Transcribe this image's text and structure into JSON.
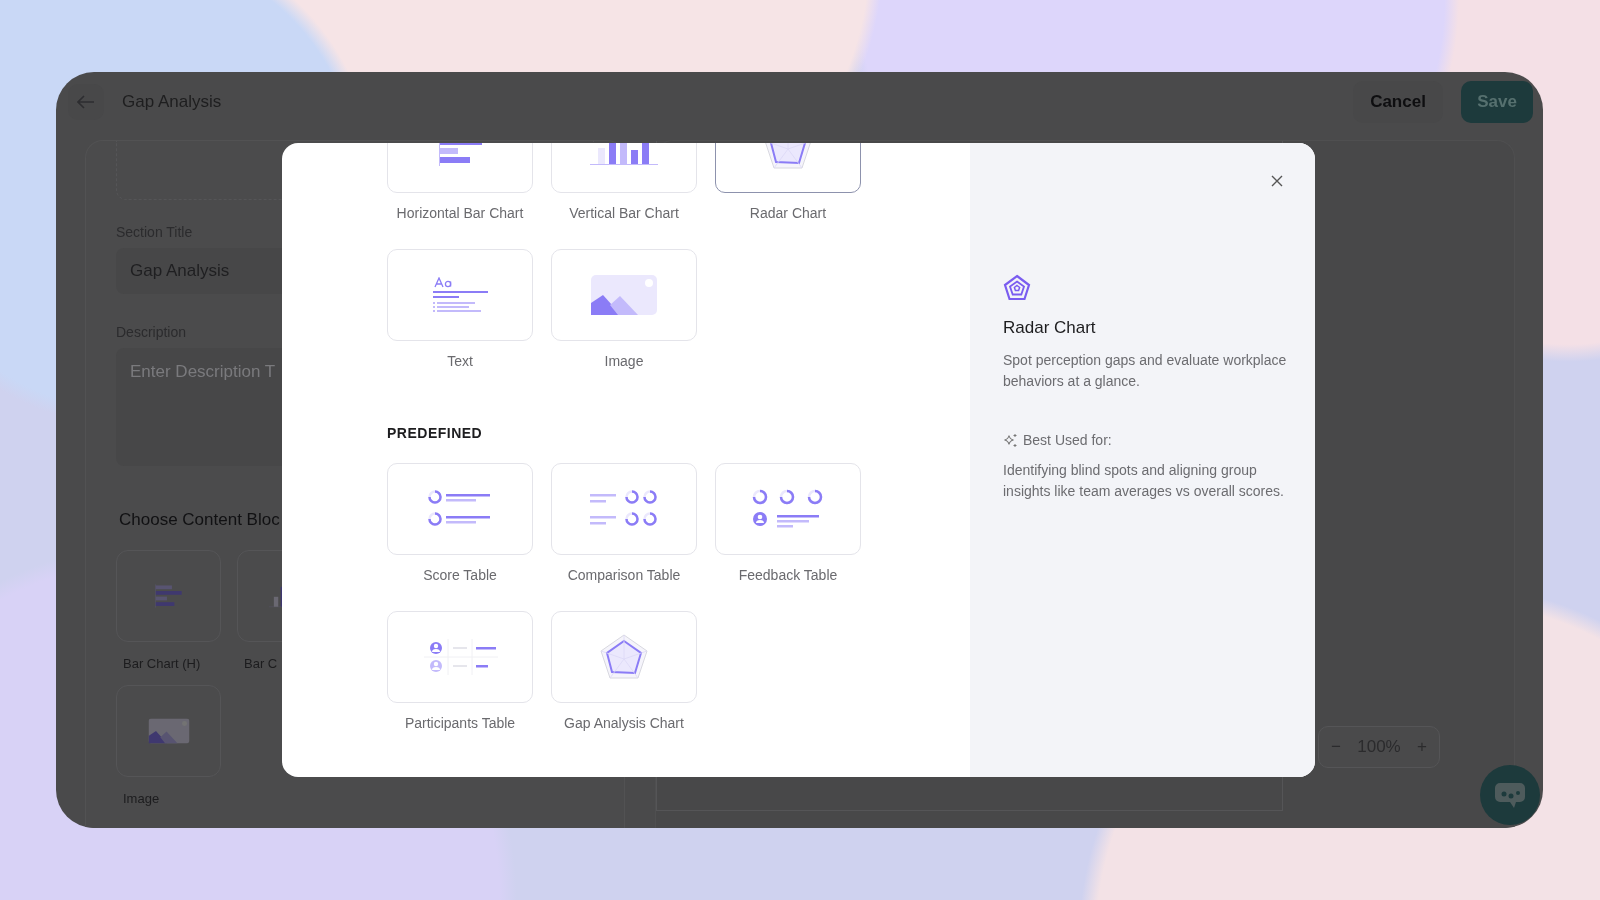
{
  "header": {
    "title": "Gap Analysis",
    "buttons": [
      {
        "label": "Cancel",
        "kind": "secondary"
      },
      {
        "label": "Save",
        "kind": "primary"
      }
    ]
  },
  "editor": {
    "section_title_label": "Section Title",
    "section_title_value": "Gap Analysis",
    "description_label": "Description",
    "description_placeholder": "Enter Description T",
    "blocks_heading": "Choose Content Bloc",
    "blocks": [
      {
        "label": "Bar Chart (H)",
        "kind": "hbar"
      },
      {
        "label": "Bar C",
        "kind": "vbar"
      },
      {
        "label": "Image",
        "kind": "image"
      }
    ]
  },
  "canvas": {
    "zoom": {
      "minus": "−",
      "value": "100%",
      "plus": "+"
    }
  },
  "modal": {
    "groups": [
      {
        "items": [
          {
            "label": "Horizontal Bar Chart",
            "kind": "hbar",
            "selected": false
          },
          {
            "label": "Vertical Bar Chart",
            "kind": "vbar",
            "selected": false
          },
          {
            "label": "Radar Chart",
            "kind": "radar",
            "selected": true
          },
          {
            "label": "Text",
            "kind": "text",
            "selected": false
          },
          {
            "label": "Image",
            "kind": "image",
            "selected": false
          }
        ]
      },
      {
        "heading": "PREDEFINED",
        "items": [
          {
            "label": "Score Table",
            "kind": "score",
            "selected": false
          },
          {
            "label": "Comparison Table",
            "kind": "comparison",
            "selected": false
          },
          {
            "label": "Feedback Table",
            "kind": "feedback",
            "selected": false
          },
          {
            "label": "Participants Table",
            "kind": "participants",
            "selected": false
          },
          {
            "label": "Gap Analysis Chart",
            "kind": "radar",
            "selected": false
          }
        ]
      }
    ],
    "detail": {
      "title": "Radar Chart",
      "description": "Spot perception gaps and evaluate workplace behaviors at a glance.",
      "best_used_label": "Best Used for:",
      "best_used_text": "Identifying blind spots and aligning group insights like team averages vs overall scores."
    }
  }
}
